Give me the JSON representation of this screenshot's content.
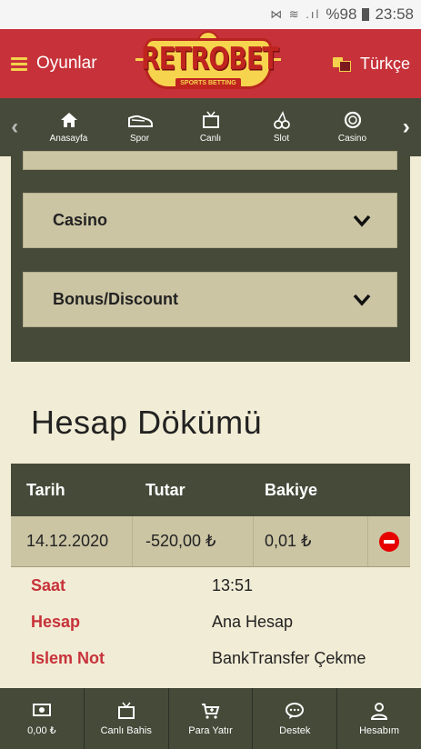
{
  "status_bar": {
    "icons": "⋈ ≋ .ıl",
    "battery": "%98",
    "time": "23:58"
  },
  "header": {
    "menu_label": "Oyunlar",
    "logo_text": "RETROBET",
    "logo_sub": "SPORTS BETTING",
    "language": "Türkçe",
    "colors": {
      "header_bg": "#c7323a",
      "accent": "#f5d24c"
    }
  },
  "nav": {
    "items": [
      {
        "label": "Anasayfa",
        "icon": "home-icon"
      },
      {
        "label": "Spor",
        "icon": "shoe-icon"
      },
      {
        "label": "Canlı",
        "icon": "tv-icon"
      },
      {
        "label": "Slot",
        "icon": "cherry-icon"
      },
      {
        "label": "Casino",
        "icon": "chip-icon"
      }
    ]
  },
  "accordion": {
    "items": [
      {
        "label": ""
      },
      {
        "label": "Casino"
      },
      {
        "label": "Bonus/Discount"
      }
    ]
  },
  "page": {
    "title": "Hesap Dökümü"
  },
  "table": {
    "headers": [
      "Tarih",
      "Tutar",
      "Bakiye"
    ],
    "rows": [
      {
        "date": "14.12.2020",
        "amount": "-520,00 ₺",
        "balance": "0,01 ₺"
      }
    ],
    "details": [
      {
        "key": "Saat",
        "value": "13:51"
      },
      {
        "key": "Hesap",
        "value": "Ana Hesap"
      },
      {
        "key": "Islem Not",
        "value": "BankTransfer Çekme"
      }
    ]
  },
  "bottom": {
    "items": [
      {
        "label": "0,00 ₺",
        "icon": "money-icon"
      },
      {
        "label": "Canlı Bahis",
        "icon": "tv-icon"
      },
      {
        "label": "Para Yatır",
        "icon": "cart-icon"
      },
      {
        "label": "Destek",
        "icon": "chat-icon"
      },
      {
        "label": "Hesabım",
        "icon": "user-icon"
      }
    ]
  }
}
